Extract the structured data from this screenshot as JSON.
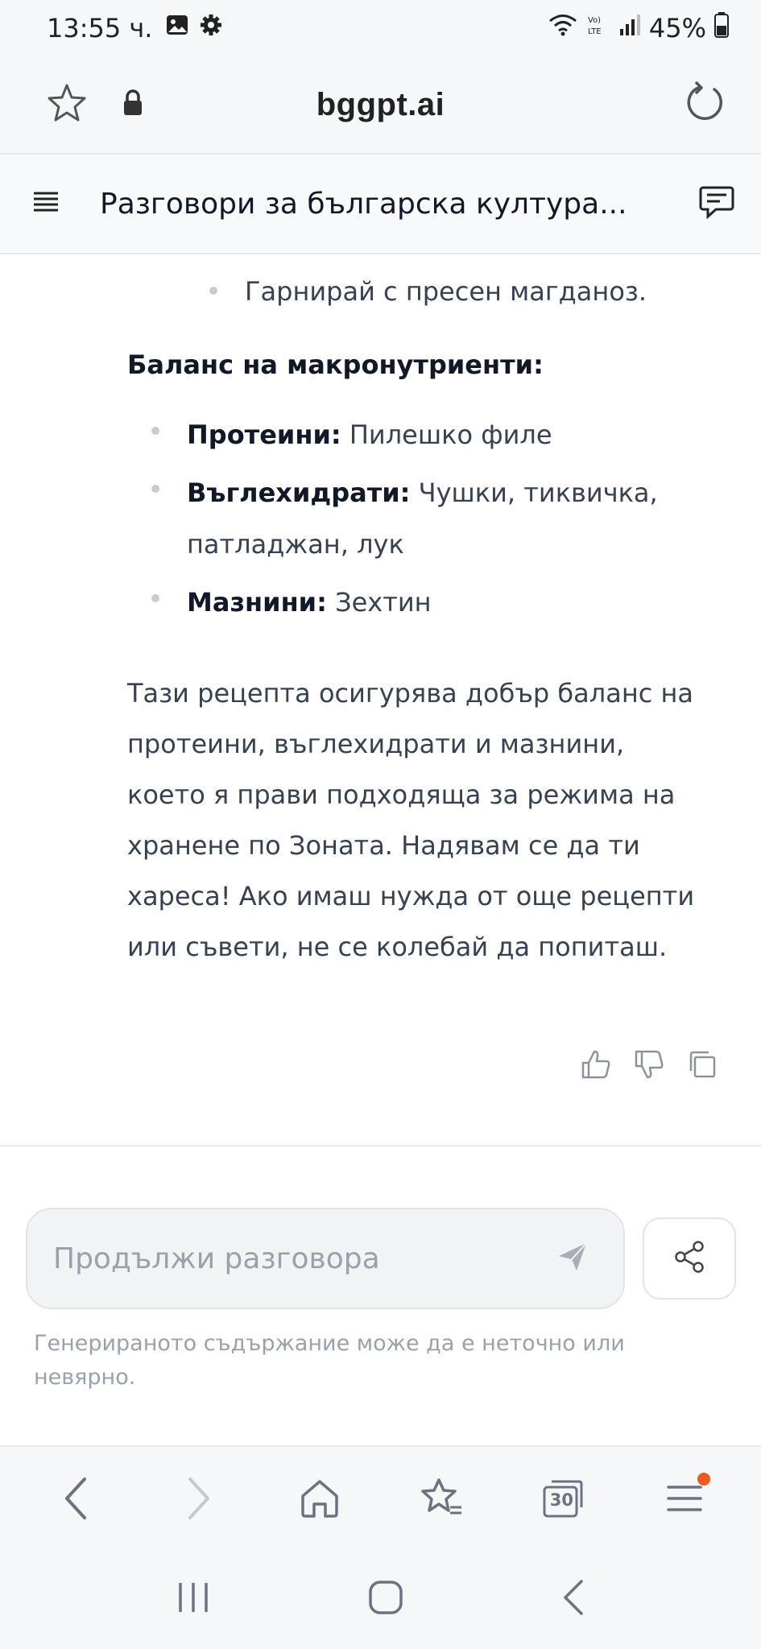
{
  "status_bar": {
    "time": "13:55 ч.",
    "battery": "45%",
    "icons": [
      "image-icon",
      "settings-gear-icon",
      "wifi-icon",
      "volte-icon",
      "signal-icon",
      "battery-icon"
    ]
  },
  "browser": {
    "domain": "bggpt.ai",
    "icons": [
      "star-icon",
      "lock-icon",
      "reload-icon"
    ]
  },
  "app_header": {
    "title": "Разговори за българска култура..."
  },
  "message": {
    "top_bullet": "Гарнирай с пресен магданоз.",
    "macro_title": "Баланс на макронутриенти:",
    "macros": [
      {
        "label": "Протеини:",
        "value": "Пилешко филе"
      },
      {
        "label": "Въглехидрати:",
        "value": "Чушки, тиквичка, патладжан, лук"
      },
      {
        "label": "Мазнини:",
        "value": "Зехтин"
      }
    ],
    "paragraph": "Тази рецепта осигурява добър баланс на протеини, въглехидрати и мазнини, което я прави подходяща за режима на хранене по Зоната. Надявам се да ти хареса! Ако имаш нужда от още рецепти или съвети, не се колебай да попиташ."
  },
  "composer": {
    "placeholder": "Продължи разговора",
    "value": ""
  },
  "disclaimer": "Генерираното съдържание може да е неточно или невярно.",
  "bottom_nav": {
    "tabs_count": "30"
  },
  "colors": {
    "badge": "#f05a22",
    "placeholder": "#9aa1ab",
    "text": "#374151"
  }
}
